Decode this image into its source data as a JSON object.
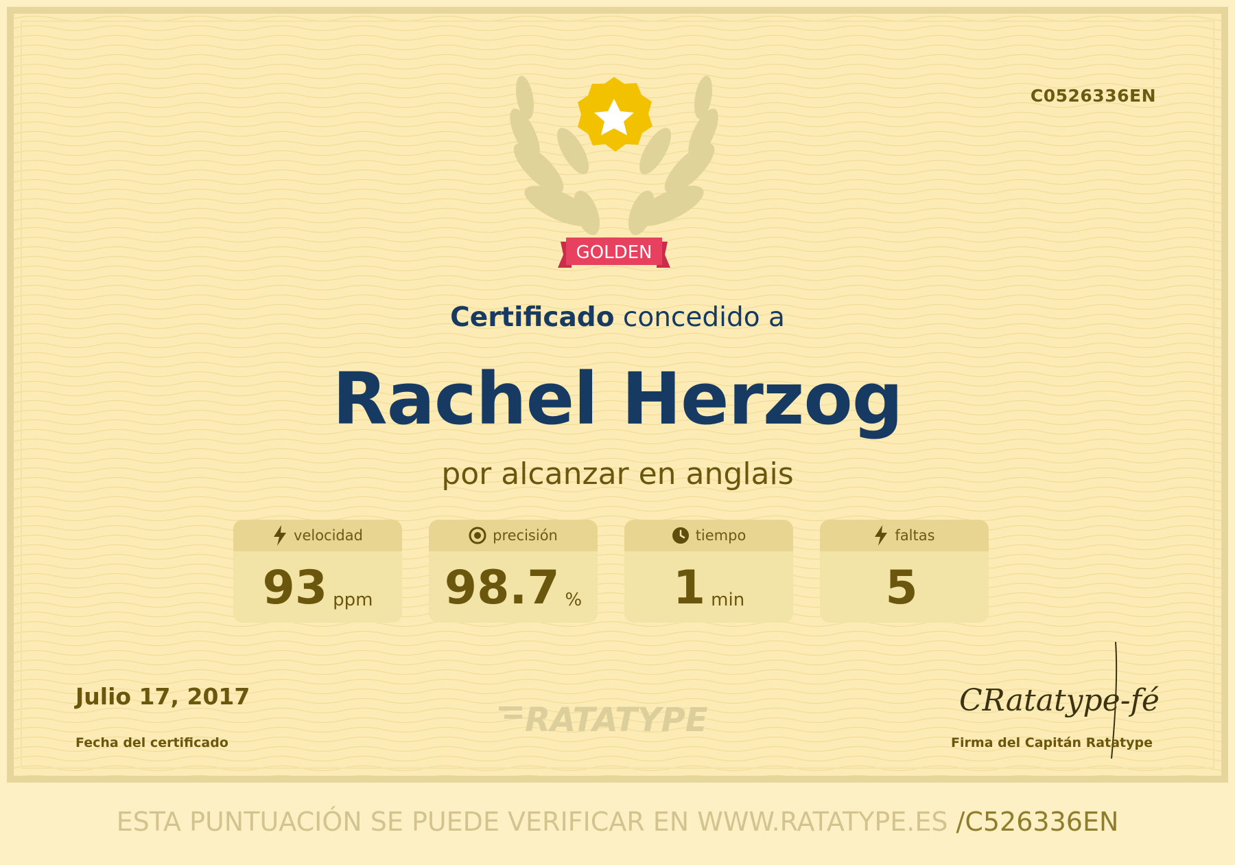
{
  "certificate": {
    "id": "C0526336EN",
    "badge_label": "GOLDEN",
    "title_bold": "Certificado",
    "title_rest": " concedido a",
    "recipient": "Rachel Herzog",
    "subtitle": "por alcanzar en anglais"
  },
  "stats": [
    {
      "label": "velocidad",
      "icon": "lightning-icon",
      "value": "93",
      "unit": "ppm"
    },
    {
      "label": "precisión",
      "icon": "target-icon",
      "value": "98.7",
      "unit": "%"
    },
    {
      "label": "tiempo",
      "icon": "clock-icon",
      "value": "1",
      "unit": "min"
    },
    {
      "label": "faltas",
      "icon": "lightning-icon",
      "value": "5",
      "unit": ""
    }
  ],
  "date": {
    "value": "Julio 17, 2017",
    "label": "Fecha del certificado"
  },
  "logo_text": "RATATYPE",
  "signature": {
    "text": "CRatatype-fé",
    "label": "Firma del Capitán Ratatype"
  },
  "footer": {
    "text": "ESTA PUNTUACIÓN SE PUEDE VERIFICAR EN WWW.RATATYPE.ES ",
    "code": "/C526336EN"
  },
  "colors": {
    "background": "#fcebb4",
    "navy": "#173a63",
    "gold_text": "#6b560d",
    "badge_red": "#e8405f",
    "star_gold": "#f2c200"
  }
}
